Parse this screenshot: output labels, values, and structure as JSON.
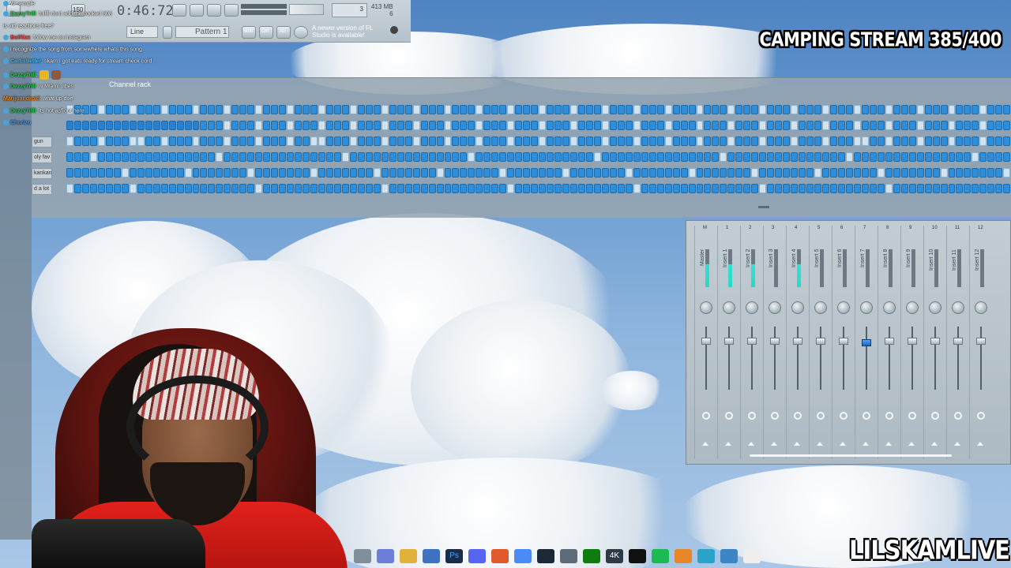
{
  "overlay": {
    "banner": "CAMPING STREAM 385/400",
    "brand": "LILSKAMLIVE"
  },
  "fl": {
    "time": "0:46:72",
    "tempo": "150",
    "pattern": "Pattern 1",
    "snap": "Line",
    "cpu": "3",
    "memory": "413 MB",
    "memory_sub": "6",
    "update_hint": "A newer version of FL Studio is available!",
    "toolbar_buttons": [
      "Shift",
      "Ctrl",
      "Alt"
    ]
  },
  "rack": {
    "title": "Channel rack",
    "rows": [
      "gun",
      "oly fav",
      "kankan",
      "d a lot"
    ]
  },
  "mixer": {
    "strips": [
      "Master",
      "Insert 1",
      "Insert 2",
      "Insert 3",
      "Insert 4",
      "Insert 5",
      "Insert 6",
      "Insert 7",
      "Insert 8",
      "Insert 9",
      "Insert 10",
      "Insert 11",
      "Insert 12"
    ],
    "numbers": [
      "M",
      "1",
      "2",
      "3",
      "4",
      "5",
      "6",
      "7",
      "8",
      "9",
      "10",
      "11",
      "12"
    ]
  },
  "chat": [
    {
      "user": "",
      "text": "W sample"
    },
    {
      "user": "DezzyTrill",
      "text": ": fulllll dont add the cooked 808"
    },
    {
      "user": "",
      "text": "is vid reactions free?"
    },
    {
      "user": "BoiRizz",
      "text": ": follow me on instagram"
    },
    {
      "user": "",
      "text": "i recognize the song from somewhere whats this song"
    },
    {
      "user": "Cartisbetter",
      "text": ": skam I got eats ready for stream check cord"
    },
    {
      "user": "DezzyTrill",
      "text": ":"
    },
    {
      "user": "DezzyTrill",
      "text": ": w Miami vibes"
    },
    {
      "user": "Marijuandroid",
      "text": ": what up doe"
    },
    {
      "user": "DezzyTrill",
      "text": ": its hot asf out here"
    },
    {
      "user": "Chorizo",
      "text": ""
    }
  ],
  "taskbar": {
    "icons": [
      "taskview-icon",
      "copilot-icon",
      "folder-icon",
      "store-icon",
      "photoshop-icon",
      "discord-icon",
      "brave-icon",
      "chrome-icon",
      "steam-icon",
      "app-icon",
      "xbox-icon",
      "4k-icon",
      "capcut-icon",
      "spotify-icon",
      "fl-icon",
      "notes-icon",
      "photos-icon",
      "file-icon"
    ],
    "ps_label": "Ps",
    "k_label": "4K"
  }
}
